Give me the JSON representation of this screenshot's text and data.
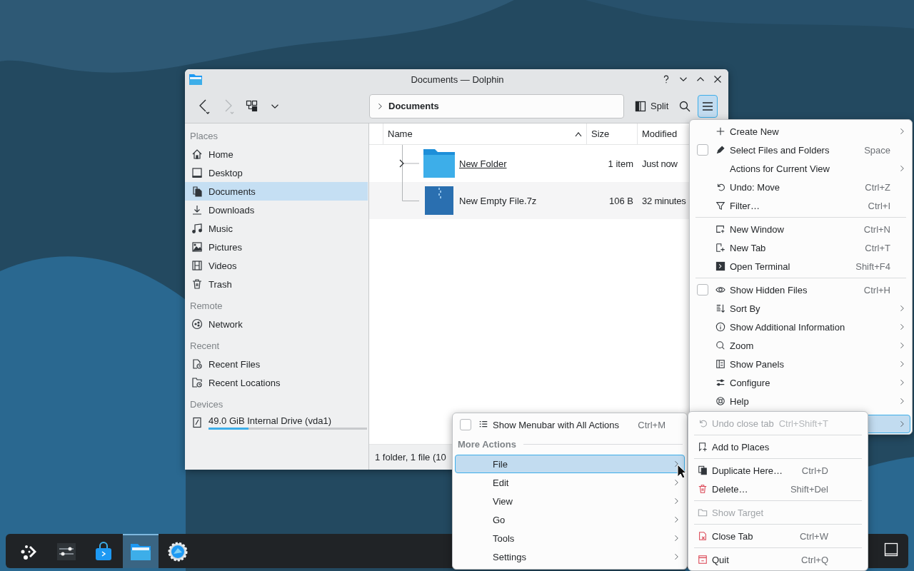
{
  "window": {
    "title": "Documents — Dolphin"
  },
  "toolbar": {
    "location": "Documents",
    "split": "Split",
    "menu_open": true
  },
  "sidebar": {
    "sections": [
      {
        "heading": "Places",
        "items": [
          {
            "label": "Home",
            "selected": false
          },
          {
            "label": "Desktop",
            "selected": false
          },
          {
            "label": "Documents",
            "selected": true
          },
          {
            "label": "Downloads",
            "selected": false
          },
          {
            "label": "Music",
            "selected": false
          },
          {
            "label": "Pictures",
            "selected": false
          },
          {
            "label": "Videos",
            "selected": false
          },
          {
            "label": "Trash",
            "selected": false
          }
        ]
      },
      {
        "heading": "Remote",
        "items": [
          {
            "label": "Network",
            "selected": false
          }
        ]
      },
      {
        "heading": "Recent",
        "items": [
          {
            "label": "Recent Files",
            "selected": false
          },
          {
            "label": "Recent Locations",
            "selected": false
          }
        ]
      },
      {
        "heading": "Devices",
        "items": [
          {
            "label": "49.0 GiB Internal Drive (vda1)",
            "selected": false,
            "level": 0.25
          }
        ]
      }
    ]
  },
  "file_list": {
    "columns": [
      "Name",
      "Size",
      "Modified"
    ],
    "rows": [
      {
        "name": "New Folder",
        "size": "1 item",
        "modified": "Just now",
        "kind": "folder",
        "hovered": true
      },
      {
        "name": "New Empty File.7z",
        "size": "106 B",
        "modified": "32 minutes",
        "kind": "archive",
        "hovered": false
      }
    ]
  },
  "status_bar": "1 folder, 1 file (10",
  "main_menu": {
    "items": [
      {
        "kind": "action",
        "label": "Create New",
        "submenu": true,
        "selected": false
      },
      {
        "kind": "checkbox",
        "label": "Select Files and Folders",
        "shortcut": "Space",
        "checked": false,
        "submenu": false,
        "selected": false
      },
      {
        "kind": "action",
        "label": "Actions for Current View",
        "submenu": true,
        "selected": false
      },
      {
        "kind": "action",
        "label": "Undo: Move",
        "shortcut": "Ctrl+Z",
        "submenu": false,
        "selected": false
      },
      {
        "kind": "action",
        "label": "Filter…",
        "shortcut": "Ctrl+I",
        "submenu": false,
        "selected": false
      },
      {
        "kind": "separator"
      },
      {
        "kind": "action",
        "label": "New Window",
        "shortcut": "Ctrl+N",
        "submenu": false,
        "selected": false
      },
      {
        "kind": "action",
        "label": "New Tab",
        "shortcut": "Ctrl+T",
        "submenu": false,
        "selected": false
      },
      {
        "kind": "action",
        "label": "Open Terminal",
        "shortcut": "Shift+F4",
        "submenu": false,
        "selected": false
      },
      {
        "kind": "separator"
      },
      {
        "kind": "checkbox",
        "label": "Show Hidden Files",
        "shortcut": "Ctrl+H",
        "checked": false,
        "submenu": false,
        "selected": false
      },
      {
        "kind": "action",
        "label": "Sort By",
        "submenu": true,
        "selected": false
      },
      {
        "kind": "action",
        "label": "Show Additional Information",
        "submenu": true,
        "selected": false
      },
      {
        "kind": "action",
        "label": "Zoom",
        "submenu": true,
        "selected": false
      },
      {
        "kind": "action",
        "label": "Show Panels",
        "submenu": true,
        "selected": false
      },
      {
        "kind": "action",
        "label": "Configure",
        "submenu": true,
        "selected": false
      },
      {
        "kind": "action",
        "label": "Help",
        "submenu": true,
        "selected": false
      },
      {
        "kind": "action",
        "submenu": true,
        "selected": true
      }
    ]
  },
  "more_menu": {
    "items": [
      {
        "kind": "checkbox",
        "label": "Show Menubar with All Actions",
        "shortcut": "Ctrl+M",
        "checked": false,
        "submenu": false,
        "selected": false
      },
      {
        "kind": "header",
        "label": "More Actions"
      },
      {
        "kind": "action",
        "label": "File",
        "submenu": true,
        "selected": true
      },
      {
        "kind": "action",
        "label": "Edit",
        "submenu": true,
        "selected": false
      },
      {
        "kind": "action",
        "label": "View",
        "submenu": true,
        "selected": false
      },
      {
        "kind": "action",
        "label": "Go",
        "submenu": true,
        "selected": false
      },
      {
        "kind": "action",
        "label": "Tools",
        "submenu": true,
        "selected": false
      },
      {
        "kind": "action",
        "label": "Settings",
        "submenu": true,
        "selected": false
      }
    ]
  },
  "file_menu": {
    "items": [
      {
        "kind": "action",
        "label": "Undo close tab",
        "shortcut": "Ctrl+Shift+T",
        "disabled": true
      },
      {
        "kind": "separator"
      },
      {
        "kind": "action",
        "label": "Add to Places",
        "disabled": false
      },
      {
        "kind": "separator"
      },
      {
        "kind": "action",
        "label": "Duplicate Here…",
        "shortcut": "Ctrl+D",
        "disabled": false
      },
      {
        "kind": "action",
        "label": "Delete…",
        "shortcut": "Shift+Del",
        "disabled": false
      },
      {
        "kind": "separator"
      },
      {
        "kind": "action",
        "label": "Show Target",
        "disabled": true
      },
      {
        "kind": "separator"
      },
      {
        "kind": "action",
        "label": "Close Tab",
        "shortcut": "Ctrl+W",
        "disabled": false
      },
      {
        "kind": "separator"
      },
      {
        "kind": "action",
        "label": "Quit",
        "shortcut": "Ctrl+Q",
        "disabled": false
      }
    ]
  },
  "taskbar": {
    "items": [
      {
        "selected": false
      },
      {
        "selected": false
      },
      {
        "selected": false
      },
      {
        "selected": true
      },
      {
        "selected": false
      }
    ]
  }
}
